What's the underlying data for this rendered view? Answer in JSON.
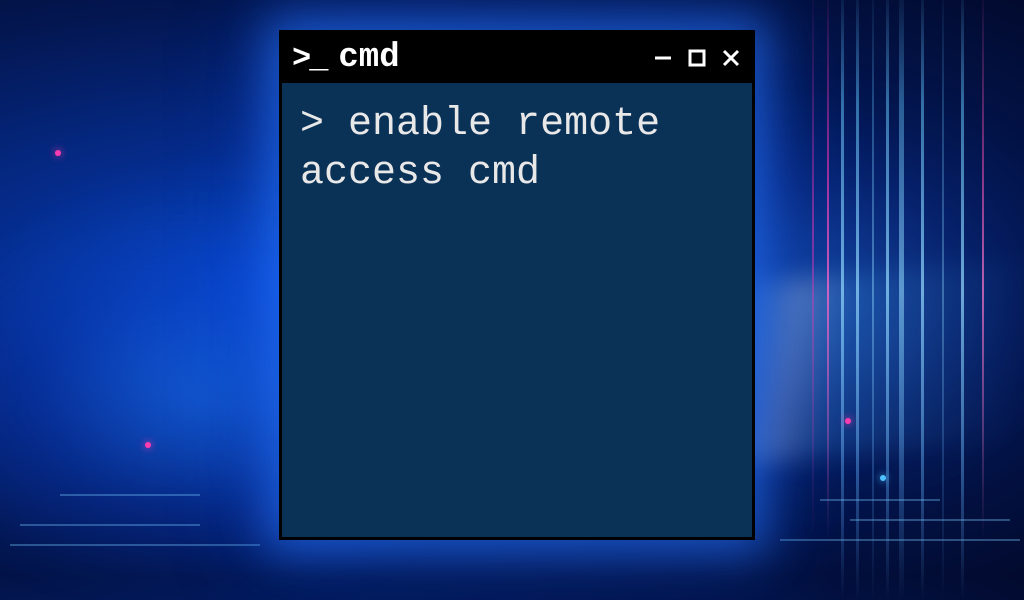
{
  "window": {
    "title": "cmd",
    "prompt_icon": ">_"
  },
  "terminal": {
    "prompt": ">",
    "command": "enable remote access cmd"
  },
  "colors": {
    "terminal_bg": "#0a3156",
    "titlebar_bg": "#000000",
    "text": "#e8e8e8",
    "glow": "#2878ff",
    "accent_pink": "#ff3cb0"
  }
}
